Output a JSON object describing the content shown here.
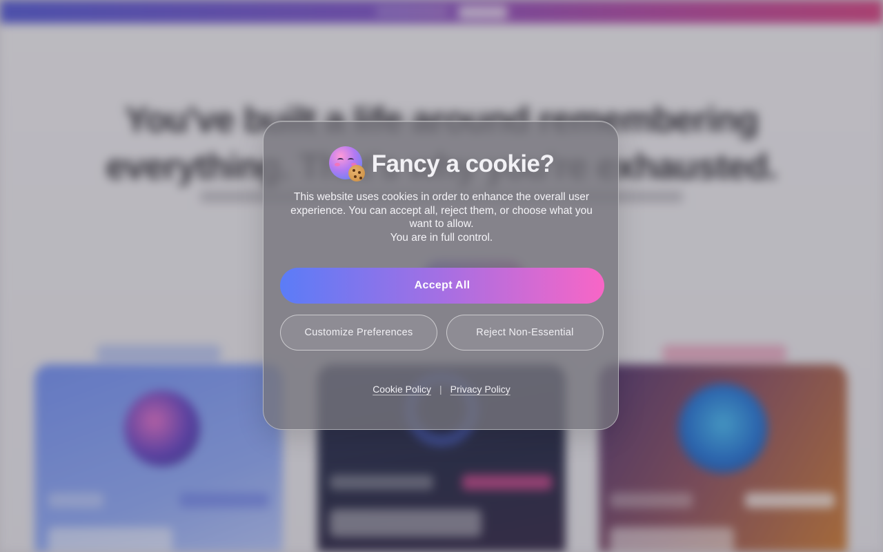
{
  "background": {
    "hero_headline": "You've built a life around remembering everything. That's why you're exhausted."
  },
  "cookie_modal": {
    "title": "Fancy a cookie?",
    "icon": "cookie-face-emoji",
    "description_lines": [
      "This website uses cookies in order to enhance the overall user experience. You can accept all, reject them, or choose what you want to allow.",
      "You are in full control."
    ],
    "accept_label": "Accept All",
    "customize_label": "Customize Preferences",
    "reject_label": "Reject Non-Essential",
    "cookie_policy_label": "Cookie Policy",
    "separator": "|",
    "privacy_policy_label": "Privacy Policy",
    "colors": {
      "accept_gradient_start": "#5b7cf7",
      "accept_gradient_end": "#f866c6"
    }
  }
}
